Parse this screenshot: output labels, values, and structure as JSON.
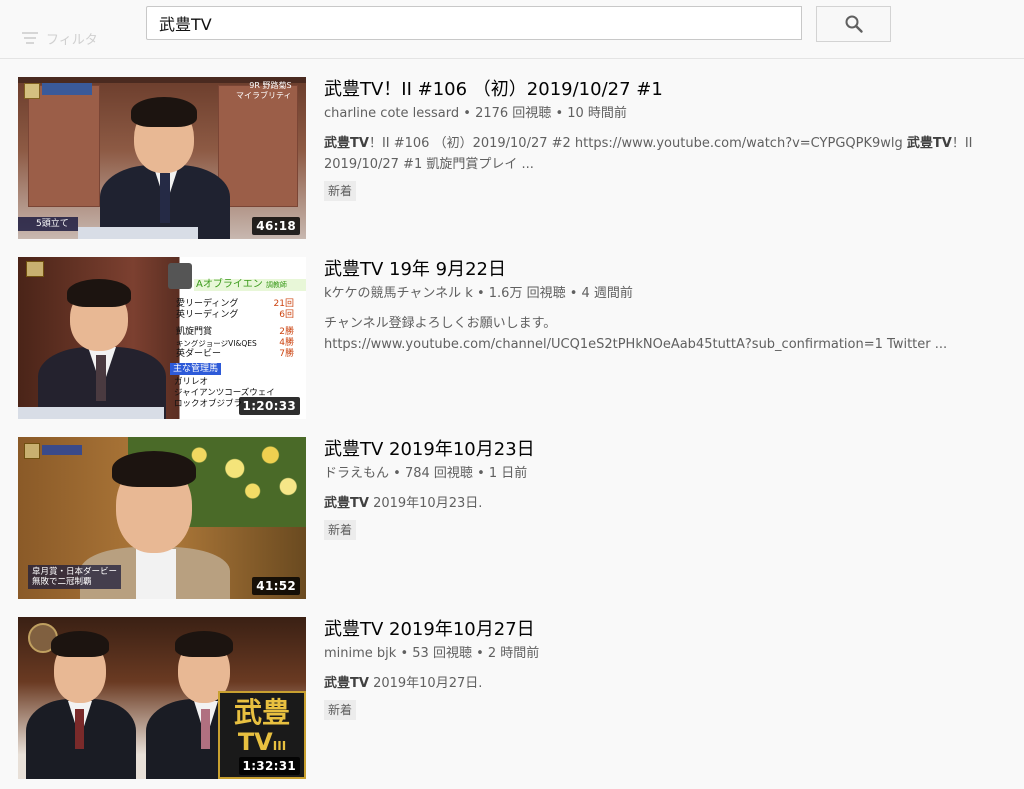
{
  "header": {
    "search_value": "武豊TV",
    "filter_label": "フィルタ",
    "search_icon": "search-icon"
  },
  "results": [
    {
      "title": "武豊TV！II #106 （初）2019/10/27 #1",
      "channel": "charline cote lessard",
      "views": "2176 回視聴",
      "age": "10 時間前",
      "desc_bold_1": "武豊TV",
      "desc_part_1": "！II #106 （初）2019/10/27 #2 https://www.youtube.com/watch?v=CYPGQPK9wlg ",
      "desc_bold_2": "武豊TV",
      "desc_part_2": "！II 2019/10/27 #1 凱旋門賞プレイ ...",
      "badge": "新着",
      "duration": "46:18",
      "thumb_caption_tl": "9R 野路菊S",
      "thumb_caption_tr": "マイラブリティ",
      "thumb_caption_bl": "5頭立て"
    },
    {
      "title": "武豊TV 19年 9月22日",
      "channel": "kケケの競馬チャンネル k",
      "views": "1.6万 回視聴",
      "age": "4 週間前",
      "desc_line_1": "チャンネル登録よろしくお願いします。",
      "desc_line_2": "https://www.youtube.com/channel/UCQ1eS2tPHkNOeAab45tuttA?sub_confirmation=1 Twitter ...",
      "duration": "1:20:33",
      "panel_header": "Aオブライエン",
      "panel_header_sub": "調教師",
      "panel_rows": [
        {
          "label": "愛リーディング",
          "value": "21回"
        },
        {
          "label": "英リーディング",
          "value": "6回"
        },
        {
          "label": "凱旋門賞",
          "value": "2勝"
        },
        {
          "label": "キングジョージVI&QES",
          "value": "4勝"
        },
        {
          "label": "英ダービー",
          "value": "7勝"
        }
      ],
      "panel_section": "主な管理馬",
      "panel_horses": [
        "ガリレオ",
        "ジャイアンツコーズウェイ",
        "ロックオブジブラ"
      ]
    },
    {
      "title": "武豊TV 2019年10月23日",
      "channel": "ドラえもん",
      "views": "784 回視聴",
      "age": "1 日前",
      "desc_bold": "武豊TV",
      "desc_rest": " 2019年10月23日.",
      "badge": "新着",
      "duration": "41:52",
      "thumb_caption_bl_1": "皐月賞・日本ダービー",
      "thumb_caption_bl_2": "無敗で二冠制覇"
    },
    {
      "title": "武豊TV 2019年10月27日",
      "channel": "minime bjk",
      "views": "53 回視聴",
      "age": "2 時間前",
      "desc_bold": "武豊TV",
      "desc_rest": " 2019年10月27日.",
      "badge": "新着",
      "duration": "1:32:31",
      "logo_text_1": "武豊",
      "logo_text_2": "TV",
      "logo_text_3": "III"
    }
  ],
  "colors": {
    "page_bg": "#f9f9f9",
    "text_primary": "#030303",
    "text_secondary": "#606060",
    "badge_bg": "#ececec"
  }
}
